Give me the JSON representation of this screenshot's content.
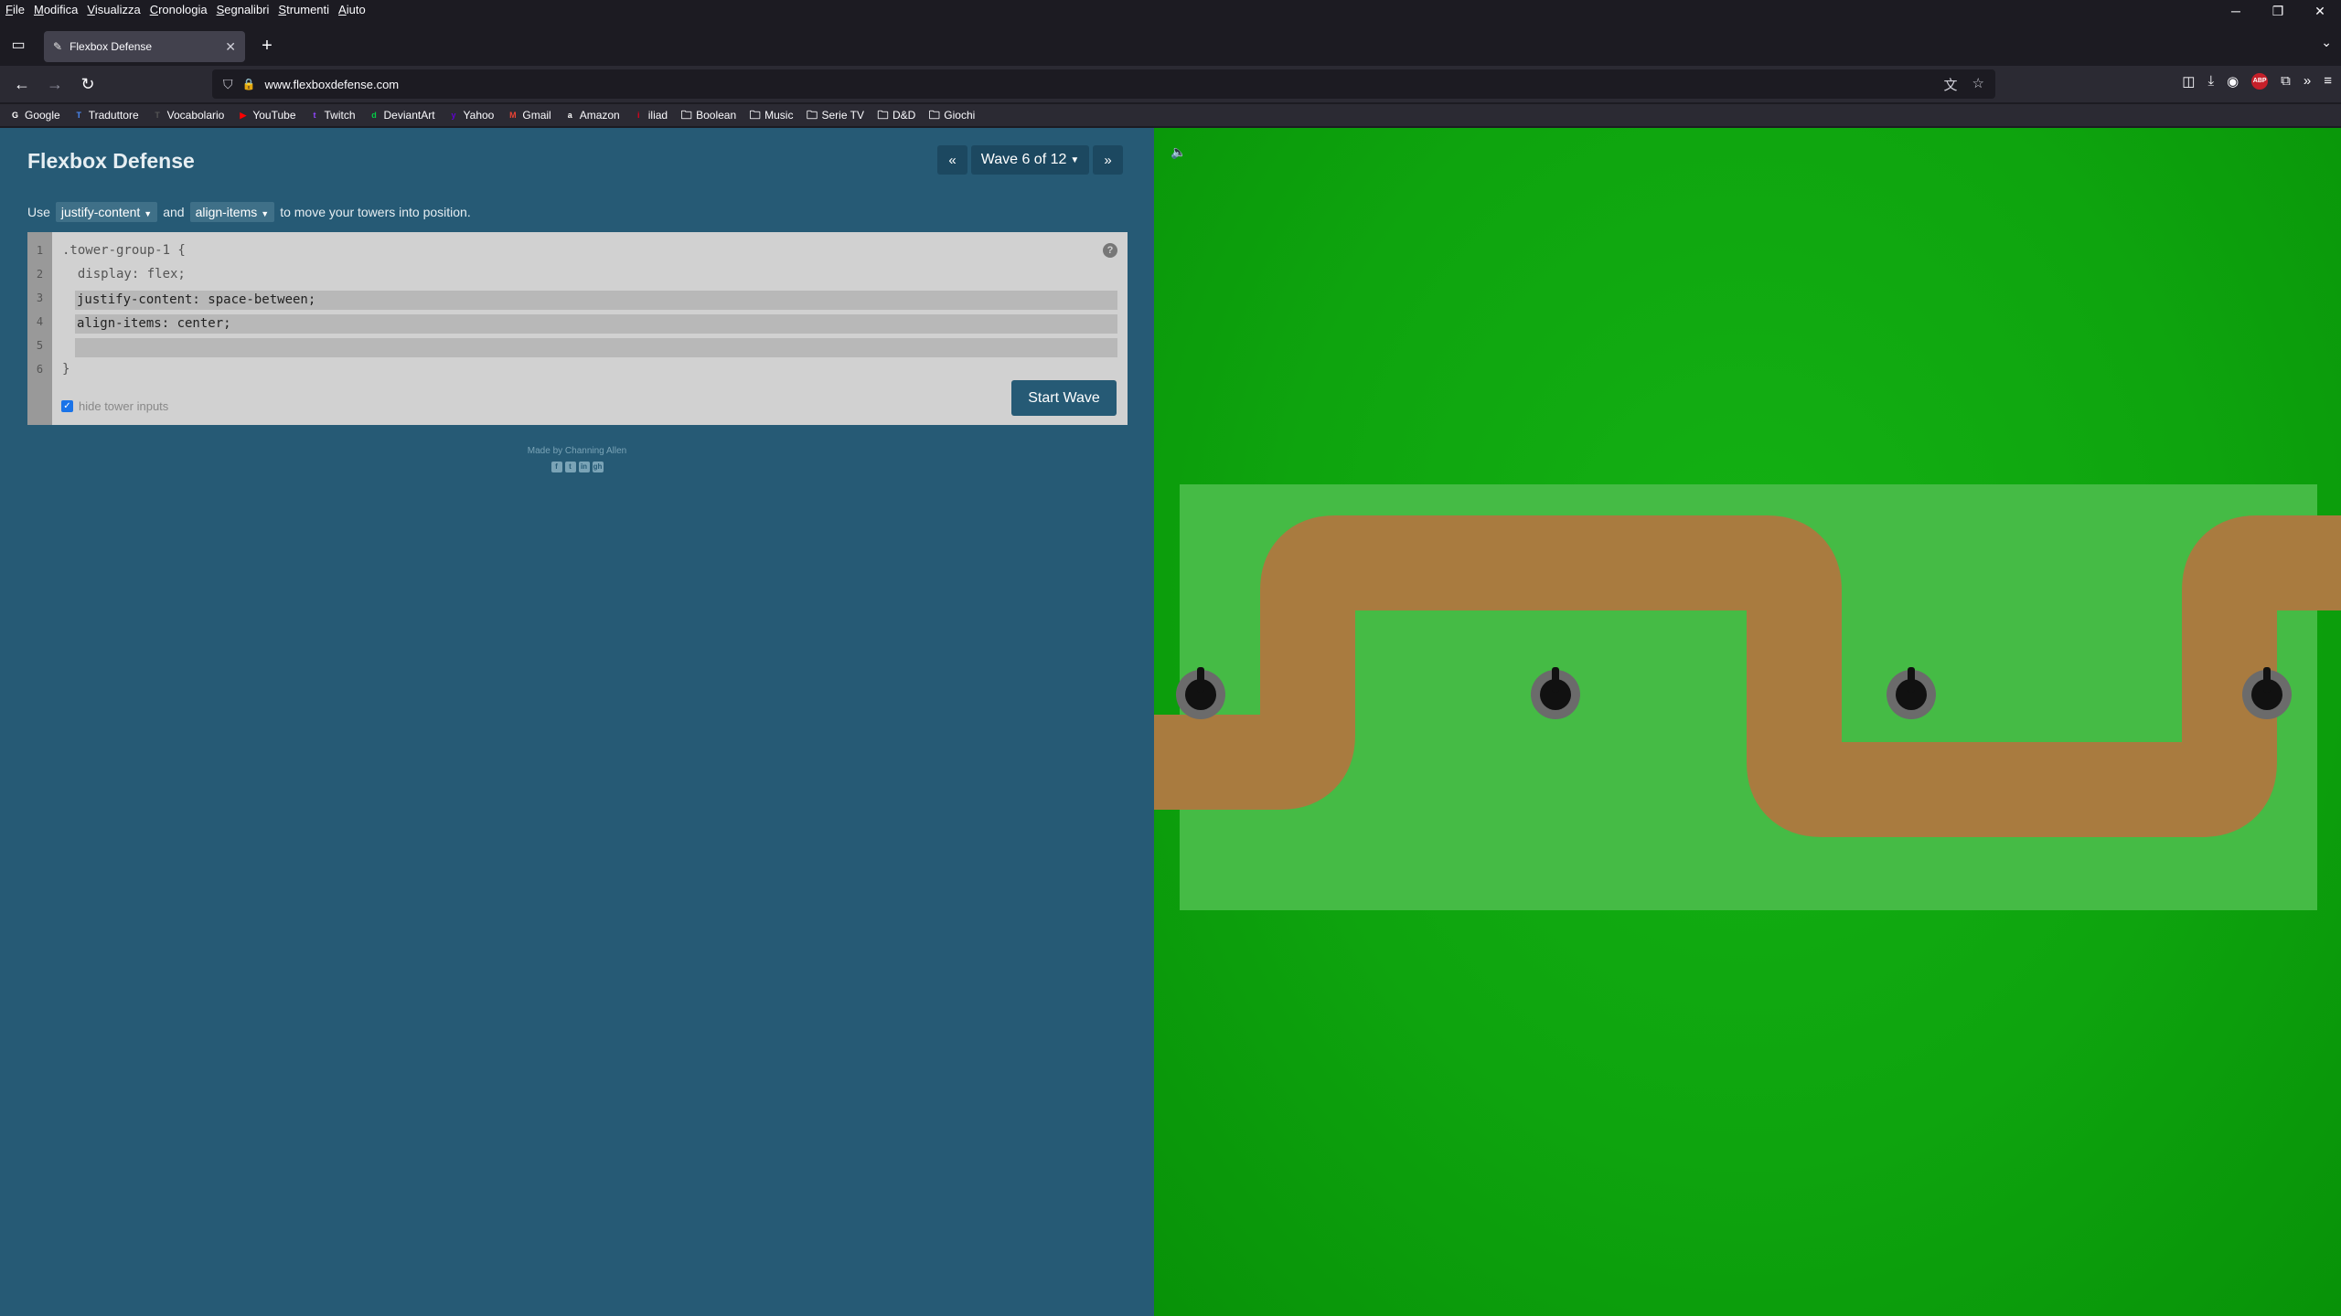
{
  "menubar": {
    "items": [
      "File",
      "Modifica",
      "Visualizza",
      "Cronologia",
      "Segnalibri",
      "Strumenti",
      "Aiuto"
    ]
  },
  "window_controls": {
    "minimize": "─",
    "restore": "❐",
    "close": "✕"
  },
  "tab": {
    "title": "Flexbox Defense",
    "close": "✕",
    "new_tab": "+"
  },
  "nav": {
    "back": "←",
    "forward": "→",
    "reload": "↻",
    "url": "www.flexboxdefense.com",
    "icons": [
      "shield-icon",
      "lock-icon",
      "translate-icon",
      "star-icon",
      "pocket-icon",
      "download-icon",
      "account-icon",
      "adblock-icon",
      "extensions-icon",
      "overflow-icon",
      "menu-icon"
    ],
    "adblock_label": "ABP"
  },
  "bookmarks": [
    {
      "label": "Google",
      "icon": "G",
      "color": "#ffffff"
    },
    {
      "label": "Traduttore",
      "icon": "T",
      "color": "#4a8af4"
    },
    {
      "label": "Vocabolario",
      "icon": "T",
      "color": "#555555"
    },
    {
      "label": "YouTube",
      "icon": "▶",
      "color": "#ff0000"
    },
    {
      "label": "Twitch",
      "icon": "t",
      "color": "#9146ff"
    },
    {
      "label": "DeviantArt",
      "icon": "d",
      "color": "#05cc47"
    },
    {
      "label": "Yahoo",
      "icon": "y",
      "color": "#6001d2"
    },
    {
      "label": "Gmail",
      "icon": "M",
      "color": "#ea4335"
    },
    {
      "label": "Amazon",
      "icon": "a",
      "color": "#ffffff"
    },
    {
      "label": "iliad",
      "icon": "i",
      "color": "#e3001b"
    },
    {
      "label": "Boolean",
      "icon": "folder",
      "color": ""
    },
    {
      "label": "Music",
      "icon": "folder",
      "color": ""
    },
    {
      "label": "Serie TV",
      "icon": "folder",
      "color": ""
    },
    {
      "label": "D&D",
      "icon": "folder",
      "color": ""
    },
    {
      "label": "Giochi",
      "icon": "folder",
      "color": ""
    }
  ],
  "game": {
    "title": "Flexbox Defense",
    "wave_prev": "«",
    "wave_label": "Wave 6 of 12",
    "wave_next": "»",
    "instructions": {
      "use": "Use",
      "prop1": "justify-content",
      "and": "and",
      "prop2": "align-items",
      "rest": "to move your towers into position."
    },
    "code": {
      "line_numbers": [
        "1",
        "2",
        "3",
        "4",
        "5",
        "6"
      ],
      "line1": ".tower-group-1 {",
      "line2": "  display: flex;",
      "input1": "justify-content: space-between;",
      "input2": "align-items: center;",
      "input3": "",
      "line6": "}"
    },
    "help": "?",
    "hide_inputs_label": "hide tower inputs",
    "hide_inputs_checked": true,
    "start_button": "Start Wave",
    "credit": "Made by Channing Allen",
    "social": [
      "f",
      "t",
      "in",
      "gh"
    ],
    "sound_icon": "🔈",
    "colors": {
      "panel": "#265a75",
      "grass": "#0ea40e",
      "zone": "#45bb45",
      "path": "#a97b3f",
      "tower": "#6b6b6b"
    },
    "tower_count": 4
  }
}
